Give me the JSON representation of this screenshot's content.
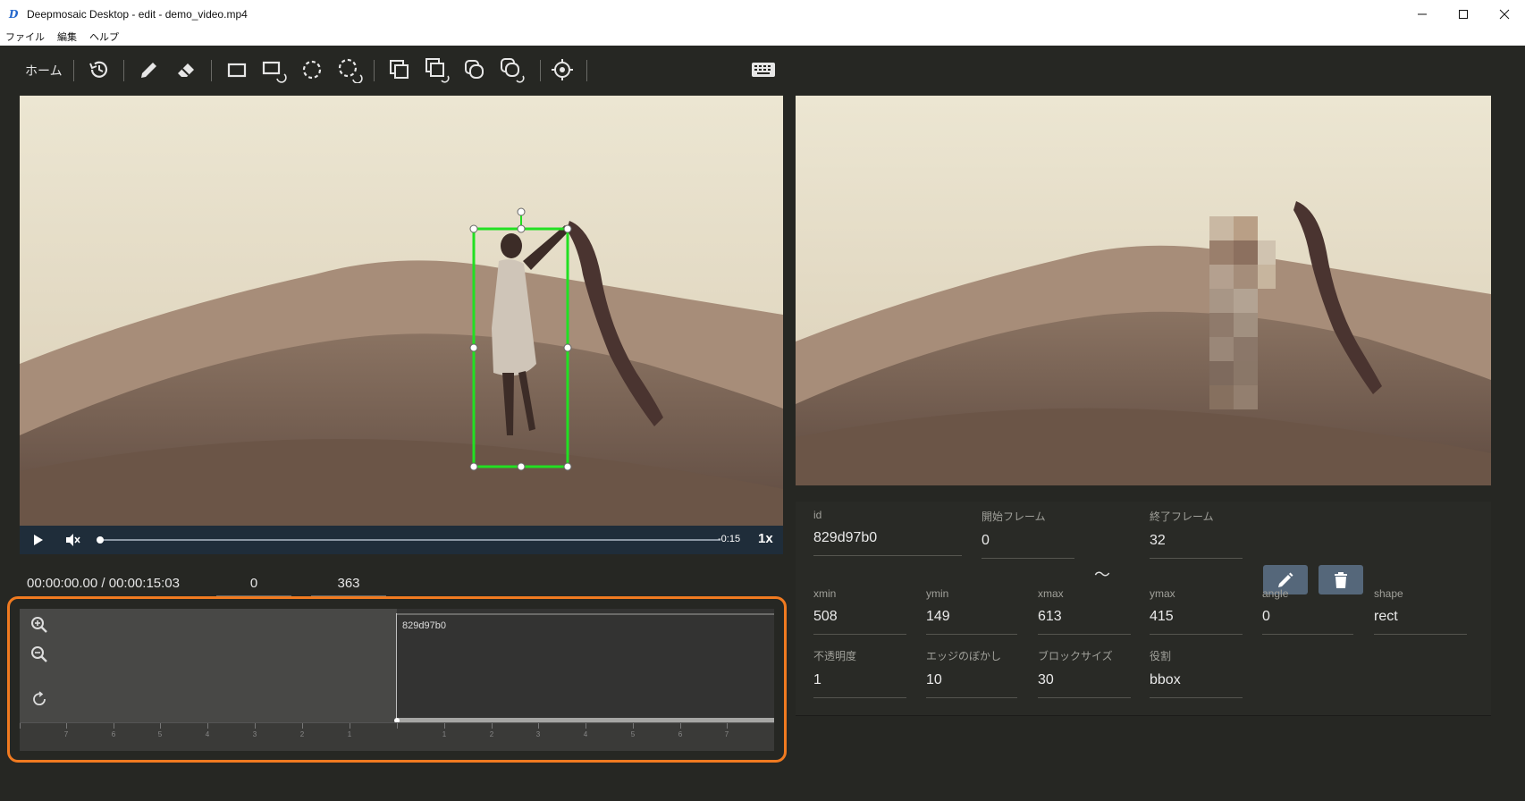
{
  "window": {
    "title": "Deepmosaic Desktop - edit - demo_video.mp4",
    "logo_letter": "D"
  },
  "menu": [
    "ファイル",
    "編集",
    "ヘルプ"
  ],
  "toolbar": {
    "home_label": "ホーム",
    "icons": [
      "history-icon",
      "pen-icon",
      "eraser-icon",
      "rect-icon",
      "rect-rotate-icon",
      "ellipse-icon",
      "ellipse-rotate-icon",
      "copy-rect-icon",
      "copy-rect-rotate-icon",
      "copy-ellipse-icon",
      "copy-ellipse-rotate-icon",
      "target-icon",
      "keyboard-icon"
    ]
  },
  "player": {
    "remaining": "-0:15",
    "speed": "1x",
    "progress": 0.0
  },
  "timeline_info": {
    "timecode": "00:00:00.00 / 00:00:15:03",
    "start_frame": "0",
    "end_frame": "363"
  },
  "timeline": {
    "clip_label": "829d97b0",
    "ticks_left": [
      "7",
      "6",
      "5",
      "4",
      "3",
      "2",
      "1"
    ],
    "ticks_right": [
      "1",
      "2",
      "3",
      "4",
      "5",
      "6",
      "7"
    ]
  },
  "props": {
    "id": {
      "label": "id",
      "value": "829d97b0"
    },
    "start": {
      "label": "開始フレーム",
      "value": "0"
    },
    "tilde": "〜",
    "end": {
      "label": "終了フレーム",
      "value": "32"
    },
    "xmin": {
      "label": "xmin",
      "value": "508"
    },
    "ymin": {
      "label": "ymin",
      "value": "149"
    },
    "xmax": {
      "label": "xmax",
      "value": "613"
    },
    "ymax": {
      "label": "ymax",
      "value": "415"
    },
    "angle": {
      "label": "angle",
      "value": "0"
    },
    "shape": {
      "label": "shape",
      "value": "rect"
    },
    "opacity": {
      "label": "不透明度",
      "value": "1"
    },
    "edge_blur": {
      "label": "エッジのぼかし",
      "value": "10"
    },
    "block_size": {
      "label": "ブロックサイズ",
      "value": "30"
    },
    "role": {
      "label": "役割",
      "value": "bbox"
    }
  },
  "colors": {
    "accent_orange": "#f07a20",
    "bbox_green": "#22e022",
    "button_blue": "#55677a",
    "panel_dark": "#262723"
  }
}
